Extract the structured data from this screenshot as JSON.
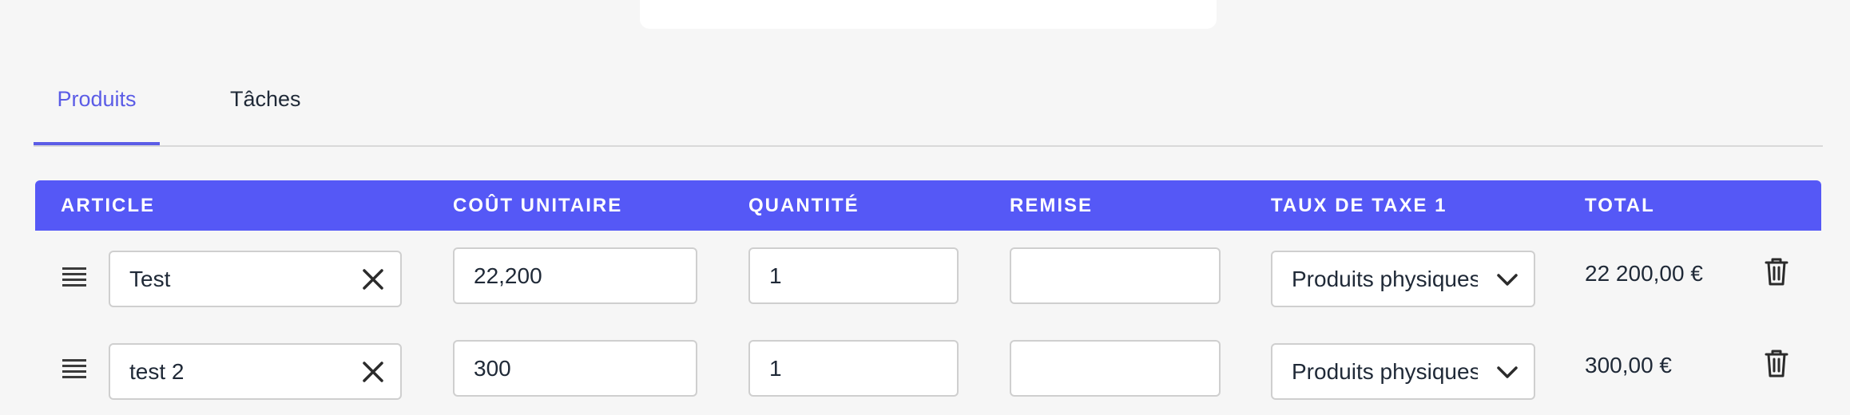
{
  "tabs": [
    {
      "label": "Produits",
      "active": true
    },
    {
      "label": "Tâches",
      "active": false
    }
  ],
  "table": {
    "columns": [
      "ARTICLE",
      "COÛT UNITAIRE",
      "QUANTITÉ",
      "REMISE",
      "TAUX DE TAXE 1",
      "TOTAL"
    ],
    "rows": [
      {
        "article": "Test",
        "unit_cost": "22,200",
        "quantity": "1",
        "discount": "",
        "tax_rate": "Produits physiques",
        "total": "22 200,00 €"
      },
      {
        "article": "test 2",
        "unit_cost": "300",
        "quantity": "1",
        "discount": "",
        "tax_rate": "Produits physiques",
        "total": "300,00 €"
      }
    ]
  },
  "colors": {
    "accent": "#5558f6",
    "tab_active": "#5b5ce6",
    "background": "#f6f6f6"
  },
  "icons": {
    "drag": "drag-handle-icon",
    "clear": "close-icon",
    "dropdown": "chevron-down-icon",
    "delete": "trash-icon"
  }
}
